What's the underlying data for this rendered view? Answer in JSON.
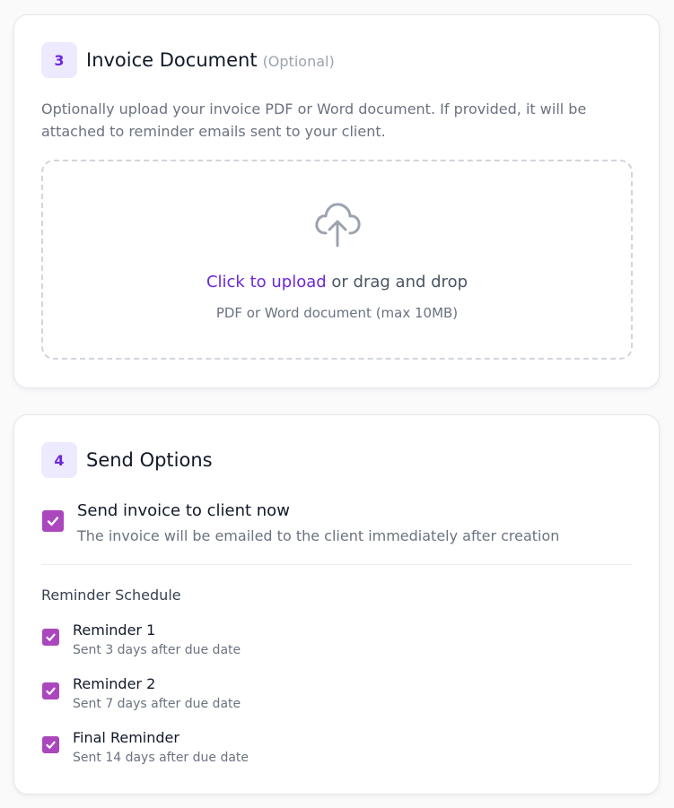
{
  "invoice_section": {
    "step": "3",
    "title": "Invoice Document",
    "optional_label": "(Optional)",
    "description": "Optionally upload your invoice PDF or Word document. If provided, it will be attached to reminder emails sent to your client.",
    "dropzone": {
      "icon": "cloud-upload-icon",
      "link_text": "Click to upload",
      "rest_text": " or drag and drop",
      "hint": "PDF or Word document (max 10MB)"
    }
  },
  "send_section": {
    "step": "4",
    "title": "Send Options",
    "send_now": {
      "checked": true,
      "label": "Send invoice to client now",
      "description": "The invoice will be emailed to the client immediately after creation"
    },
    "reminder_heading": "Reminder Schedule",
    "reminders": [
      {
        "checked": true,
        "label": "Reminder 1",
        "sub": "Sent 3 days after due date"
      },
      {
        "checked": true,
        "label": "Reminder 2",
        "sub": "Sent 7 days after due date"
      },
      {
        "checked": true,
        "label": "Final Reminder",
        "sub": "Sent 14 days after due date"
      }
    ]
  },
  "colors": {
    "accent": "#6d28d9",
    "badge_bg": "#ede9fe",
    "checkbox": "#ab47bc"
  }
}
